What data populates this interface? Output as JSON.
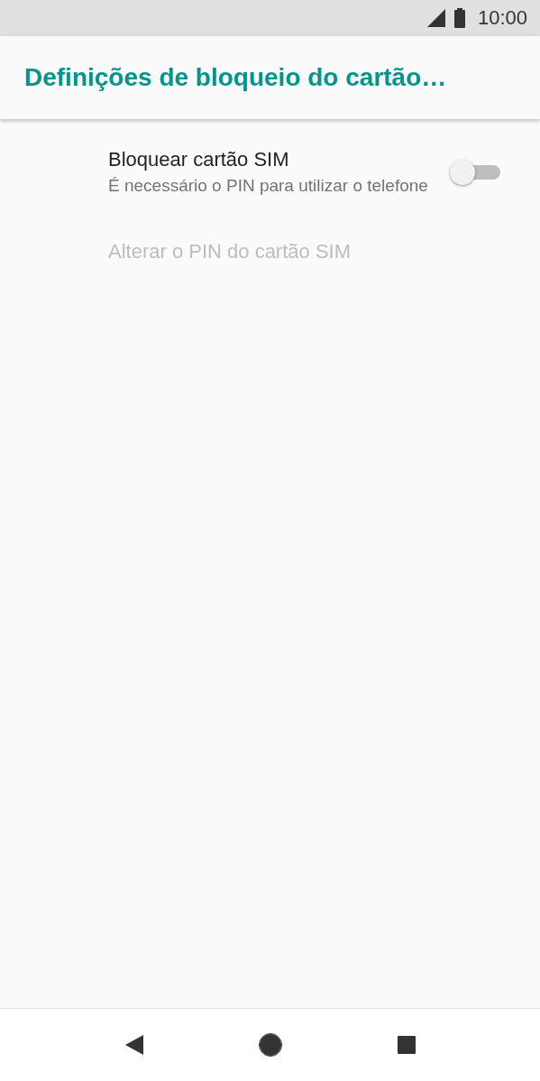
{
  "status_bar": {
    "time": "10:00"
  },
  "app_bar": {
    "title": "Definições de bloqueio do cartão…"
  },
  "preferences": [
    {
      "kind": "switch",
      "title": "Bloquear cartão SIM",
      "summary": "É necessário o PIN para utilizar o telefone",
      "on": false,
      "disabled": false
    },
    {
      "kind": "plain",
      "title": "Alterar o PIN do cartão SIM",
      "disabled": true
    }
  ]
}
